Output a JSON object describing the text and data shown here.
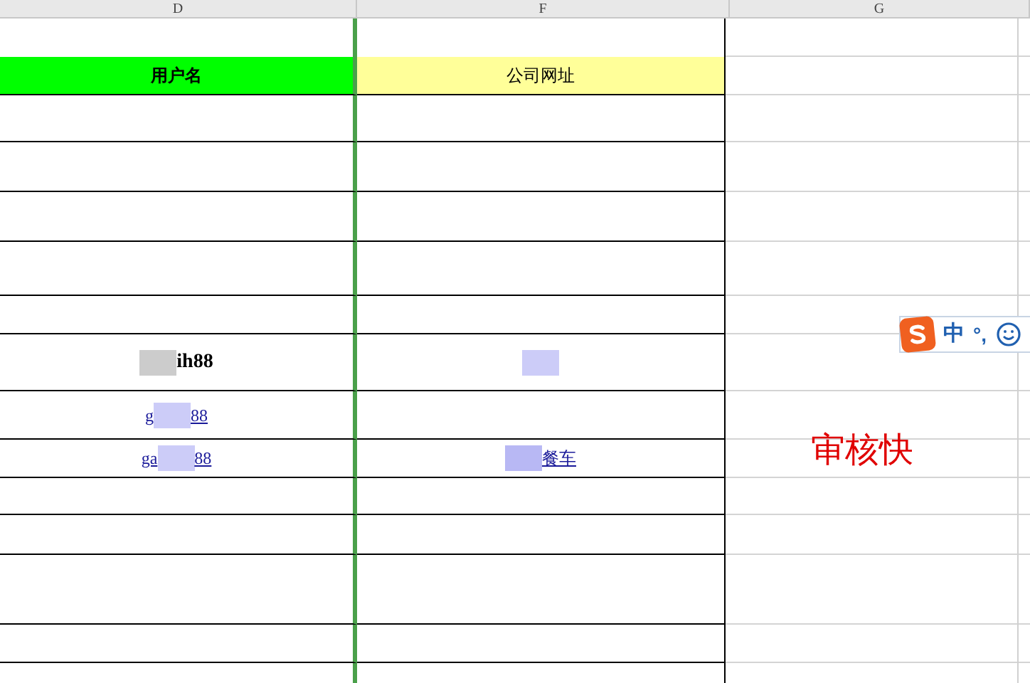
{
  "column_headers": [
    {
      "label": "D"
    },
    {
      "label": "F"
    },
    {
      "label": "G"
    }
  ],
  "header_row": {
    "username": "用户名",
    "website": "公司网址"
  },
  "data_rows": [
    {
      "username": {
        "bold": true,
        "link": false,
        "parts": [
          {
            "kind": "redacted",
            "color": "#cccccc"
          },
          {
            "kind": "text",
            "text": "ih88"
          }
        ]
      },
      "website": {
        "parts": [
          {
            "kind": "redacted",
            "color": "#ccccf8"
          }
        ]
      }
    },
    {
      "username": {
        "bold": false,
        "link": true,
        "parts": [
          {
            "kind": "text",
            "text": "g"
          },
          {
            "kind": "redacted",
            "color": "#ccccf8"
          },
          {
            "kind": "text",
            "text": "88"
          }
        ]
      }
    },
    {
      "username": {
        "bold": false,
        "link": true,
        "parts": [
          {
            "kind": "text",
            "text": "ga"
          },
          {
            "kind": "redacted",
            "color": "#ccccf8"
          },
          {
            "kind": "text",
            "text": "88"
          }
        ]
      },
      "website": {
        "bold": false,
        "link": true,
        "parts": [
          {
            "kind": "redacted",
            "color": "#b8b8f4"
          },
          {
            "kind": "text",
            "text": "餐车"
          }
        ]
      },
      "note": "审核快"
    }
  ],
  "ime_bar": {
    "mode": "中",
    "punctuation": "°,"
  }
}
